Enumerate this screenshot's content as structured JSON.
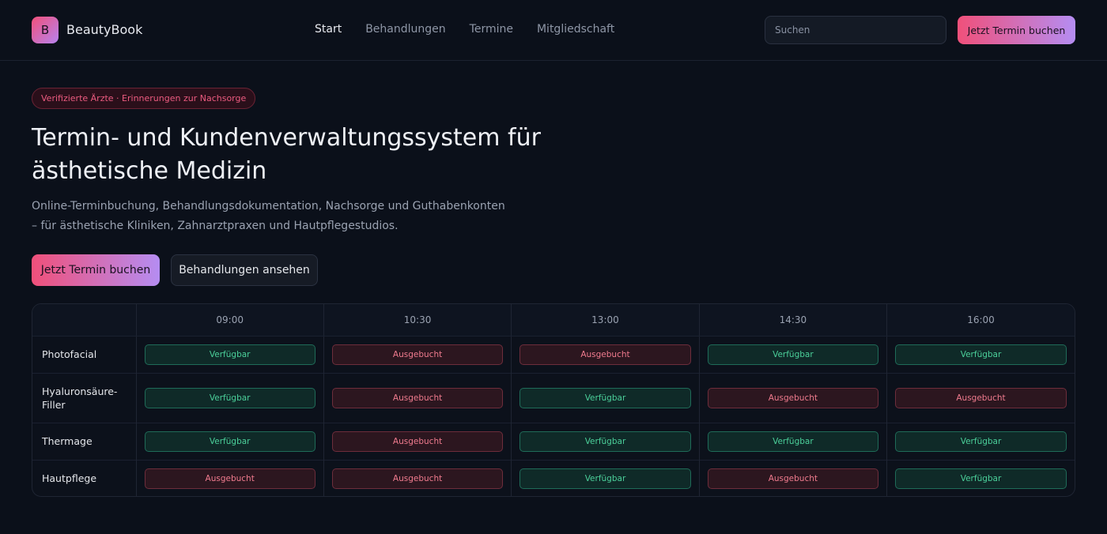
{
  "header": {
    "logo_letter": "B",
    "brand": "BeautyBook",
    "nav": [
      "Start",
      "Behandlungen",
      "Termine",
      "Mitgliedschaft"
    ],
    "search_placeholder": "Suchen",
    "cta": "Jetzt Termin buchen"
  },
  "hero": {
    "pill": "Verifizierte Ärzte · Erinnerungen zur Nachsorge",
    "title": "Termin- und Kundenverwaltungssystem für ästhetische Medizin",
    "subtitle": "Online-Terminbuchung, Behandlungsdokumentation, Nachsorge und Guthabenkonten – für ästhetische Kliniken, Zahnarztpraxen und Hautpflegestudios.",
    "primary_cta": "Jetzt Termin buchen",
    "secondary_cta": "Behandlungen ansehen"
  },
  "schedule": {
    "times": [
      "09:00",
      "10:30",
      "13:00",
      "14:30",
      "16:00"
    ],
    "rows": [
      {
        "treatment": "Photofacial",
        "slots": [
          "Verfügbar",
          "Ausgebucht",
          "Ausgebucht",
          "Verfügbar",
          "Verfügbar"
        ]
      },
      {
        "treatment": "Hyaluronsäure-Filler",
        "slots": [
          "Verfügbar",
          "Ausgebucht",
          "Verfügbar",
          "Ausgebucht",
          "Ausgebucht"
        ]
      },
      {
        "treatment": "Thermage",
        "slots": [
          "Verfügbar",
          "Ausgebucht",
          "Verfügbar",
          "Verfügbar",
          "Verfügbar"
        ]
      },
      {
        "treatment": "Hautpflege",
        "slots": [
          "Ausgebucht",
          "Ausgebucht",
          "Verfügbar",
          "Ausgebucht",
          "Verfügbar"
        ]
      }
    ]
  },
  "colors": {
    "accent_start": "#f0507a",
    "accent_end": "#b58df2",
    "available": "#4bd09a",
    "booked": "#f07b8e",
    "background": "#0b101a"
  }
}
